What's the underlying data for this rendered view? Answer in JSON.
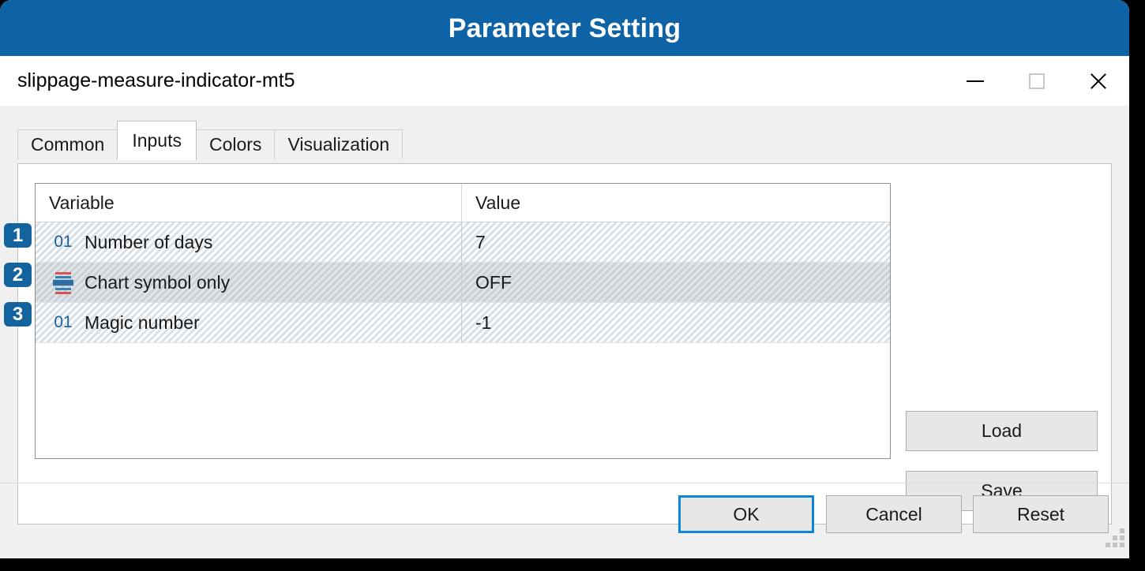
{
  "banner": {
    "title": "Parameter Setting",
    "background_color": "#0d63a5",
    "text_color": "#ffffff"
  },
  "titlebar": {
    "title": "slippage-measure-indicator-mt5",
    "controls": {
      "minimize_label": "Minimize",
      "maximize_label": "Maximize",
      "close_label": "Close"
    }
  },
  "tabs": [
    {
      "label": "Common",
      "active": false
    },
    {
      "label": "Inputs",
      "active": true
    },
    {
      "label": "Colors",
      "active": false
    },
    {
      "label": "Visualization",
      "active": false
    }
  ],
  "table": {
    "columns": [
      "Variable",
      "Value"
    ],
    "rows": [
      {
        "badge": "1",
        "icon": "numeric-input-icon",
        "icon_text": "01",
        "variable": "Number of days",
        "value": "7",
        "selected": false
      },
      {
        "badge": "2",
        "icon": "boolean-input-icon",
        "icon_text": "",
        "variable": "Chart symbol only",
        "value": "OFF",
        "selected": true
      },
      {
        "badge": "3",
        "icon": "numeric-input-icon",
        "icon_text": "01",
        "variable": "Magic number",
        "value": "-1",
        "selected": false
      }
    ]
  },
  "side_buttons": {
    "load_label": "Load",
    "save_label": "Save"
  },
  "footer_buttons": {
    "ok_label": "OK",
    "cancel_label": "Cancel",
    "reset_label": "Reset",
    "focus_color": "#0a85d8"
  }
}
